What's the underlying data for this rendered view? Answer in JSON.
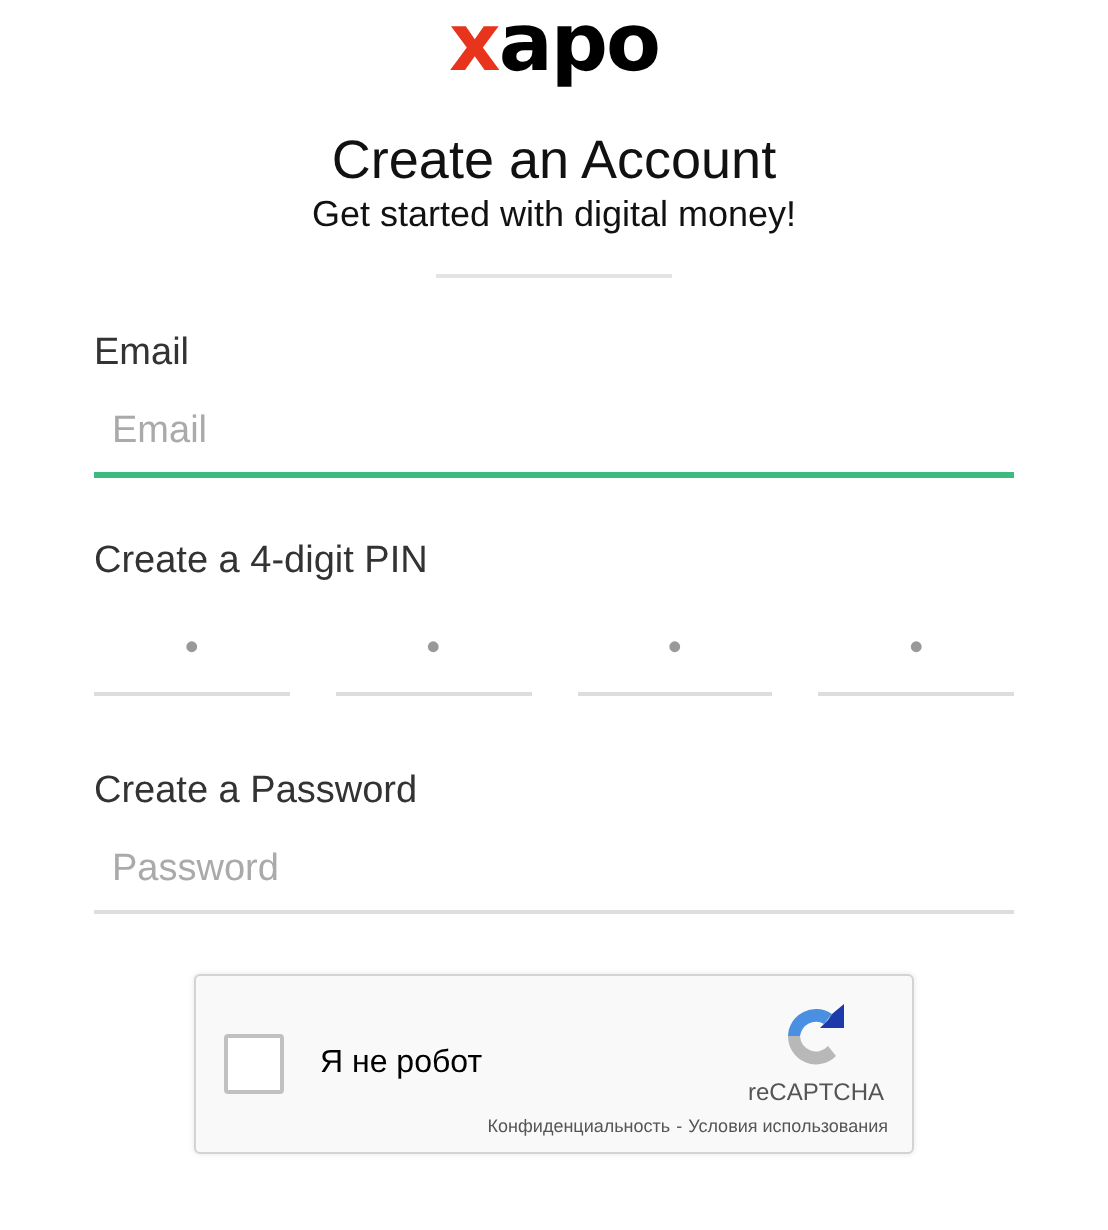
{
  "logo": "xapo",
  "title": "Create an Account",
  "subtitle": "Get started with digital money!",
  "fields": [
    {
      "kind": "text",
      "label": "Email",
      "placeholder": "Email",
      "focused": true
    },
    {
      "kind": "pin",
      "label": "Create a 4-digit PIN",
      "digits": [
        {
          "placeholder": "•"
        },
        {
          "placeholder": "•"
        },
        {
          "placeholder": "•"
        },
        {
          "placeholder": "•"
        }
      ]
    },
    {
      "kind": "password",
      "label": "Create a Password",
      "placeholder": "Password",
      "focused": false
    }
  ],
  "captcha": {
    "checked": false,
    "label": "Я не робот",
    "brand": "reCAPTCHA",
    "privacy": "Конфиденциальность",
    "separator": "-",
    "terms": "Условия использования"
  }
}
